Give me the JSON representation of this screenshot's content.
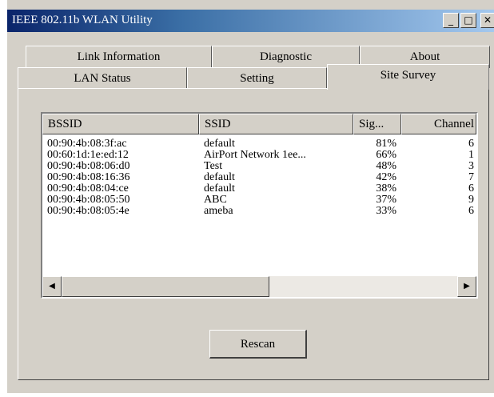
{
  "window": {
    "title": "IEEE 802.11b WLAN Utility"
  },
  "caption_buttons": {
    "minimize": "_",
    "maximize": "□",
    "close": "✕"
  },
  "tabs": {
    "row1": [
      "Link Information",
      "Diagnostic",
      "About"
    ],
    "row2": [
      "LAN Status",
      "Setting",
      "Site Survey"
    ],
    "active": "Site Survey"
  },
  "survey": {
    "columns": [
      "BSSID",
      "SSID",
      "Sig...",
      "Channel"
    ],
    "rows": [
      {
        "bssid": "00:90:4b:08:3f:ac",
        "ssid": "default",
        "signal": "81%",
        "channel": "6"
      },
      {
        "bssid": "00:60:1d:1e:ed:12",
        "ssid": "AirPort Network 1ee...",
        "signal": "66%",
        "channel": "1"
      },
      {
        "bssid": "00:90:4b:08:06:d0",
        "ssid": "Test",
        "signal": "48%",
        "channel": "3"
      },
      {
        "bssid": "00:90:4b:08:16:36",
        "ssid": "default",
        "signal": "42%",
        "channel": "7"
      },
      {
        "bssid": "00:90:4b:08:04:ce",
        "ssid": "default",
        "signal": "38%",
        "channel": "6"
      },
      {
        "bssid": "00:90:4b:08:05:50",
        "ssid": "ABC",
        "signal": "37%",
        "channel": "9"
      },
      {
        "bssid": "00:90:4b:08:05:4e",
        "ssid": "ameba",
        "signal": "33%",
        "channel": "6"
      }
    ]
  },
  "buttons": {
    "rescan": "Rescan"
  },
  "scrollbar": {
    "left_arrow": "◀",
    "right_arrow": "▶"
  }
}
